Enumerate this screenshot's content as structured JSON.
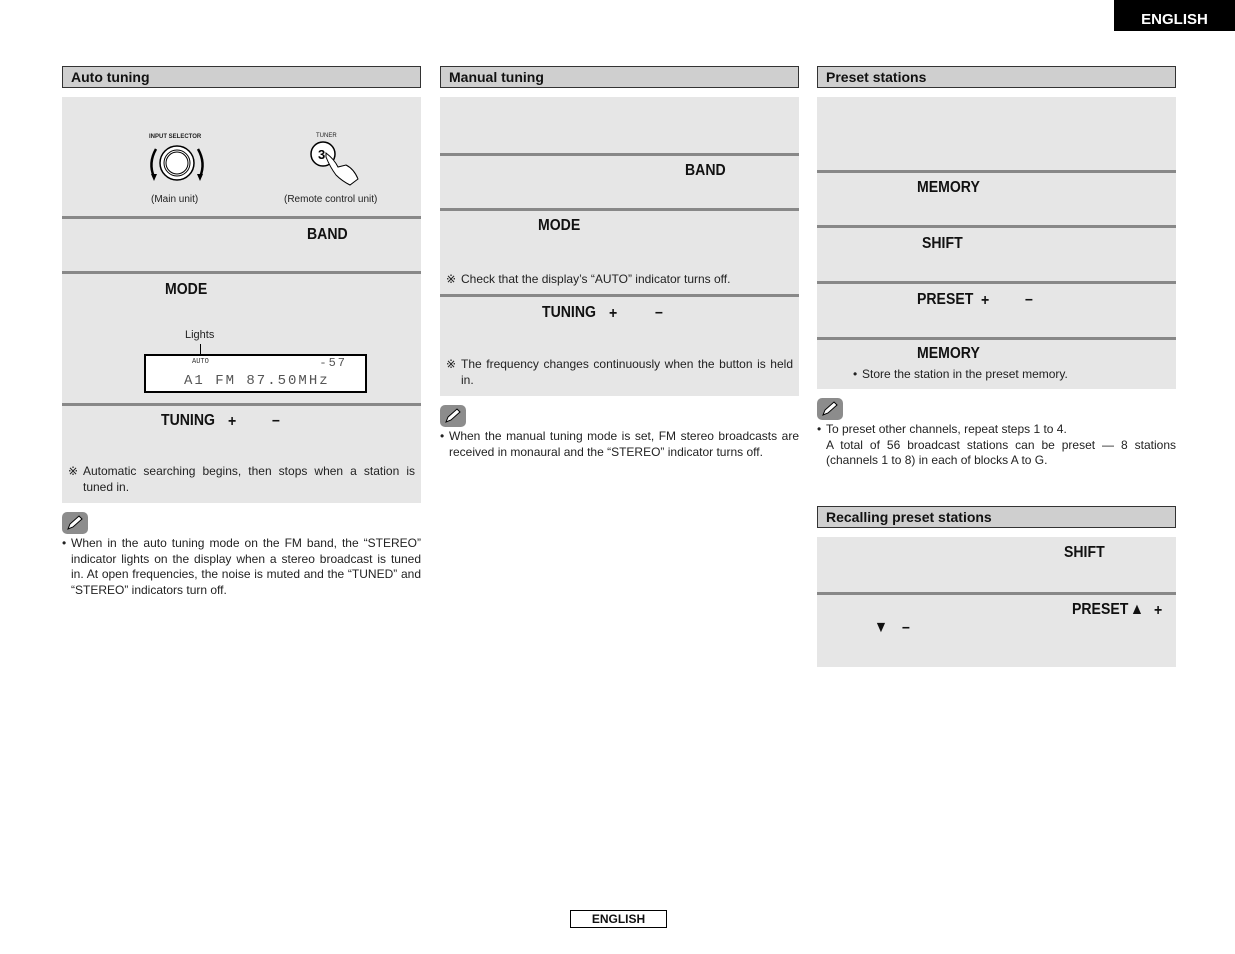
{
  "header": {
    "language_tab": "ENGLISH"
  },
  "footer": {
    "language_label": "ENGLISH"
  },
  "auto_tuning": {
    "title": "Auto tuning",
    "illustration": {
      "main_unit_knob_label": "INPUT SELECTOR",
      "main_unit_caption": "(Main unit)",
      "remote_button_label": "TUNER",
      "remote_button_number": "3",
      "remote_caption": "(Remote control unit)"
    },
    "step_band_key": "BAND",
    "step_mode_key": "MODE",
    "display": {
      "lights_label": "Lights",
      "indicator": "AUTO",
      "signal": "-57",
      "main_line": "A1 FM 87.50MHz"
    },
    "step_tuning": {
      "key": "TUNING",
      "plus": "+",
      "minus": "–"
    },
    "step_tuning_note": {
      "mark": "※",
      "text": "Automatic searching begins, then stops when a station is tuned in."
    },
    "memo": "When in the auto tuning mode on the FM band, the “STEREO” indicator lights on the display when a stereo broadcast is tuned in. At open frequencies, the noise is muted and the “TUNED” and “STEREO” indicators turn off."
  },
  "manual_tuning": {
    "title": "Manual tuning",
    "step_band_key": "BAND",
    "step_mode_key": "MODE",
    "step_mode_note": {
      "mark": "※",
      "text": "Check that the display’s “AUTO” indicator turns off."
    },
    "step_tuning": {
      "key": "TUNING",
      "plus": "+",
      "minus": "–"
    },
    "step_tuning_note": {
      "mark": "※",
      "text": "The frequency changes continuously when the button is held in."
    },
    "memo": "When the manual tuning mode is set, FM stereo broadcasts are received in monaural and the “STEREO” indicator turns off."
  },
  "preset_stations": {
    "title": "Preset stations",
    "step_memory_key": "MEMORY",
    "step_shift_key": "SHIFT",
    "step_preset": {
      "key": "PRESET",
      "plus": "+",
      "minus": "–"
    },
    "step_memory2_key": "MEMORY",
    "step_memory2_note": "Store the station in the preset memory.",
    "memo_line1": "To preset other channels, repeat steps 1 to 4.",
    "memo_line2": "A total of 56 broadcast stations can be preset — 8 stations (channels 1 to 8) in each of blocks A to G."
  },
  "recalling_preset": {
    "title": "Recalling preset stations",
    "step_shift_key": "SHIFT",
    "step_preset": {
      "key": "PRESET",
      "up": "▲",
      "plus": "+",
      "down": "▼",
      "minus": "–"
    }
  }
}
